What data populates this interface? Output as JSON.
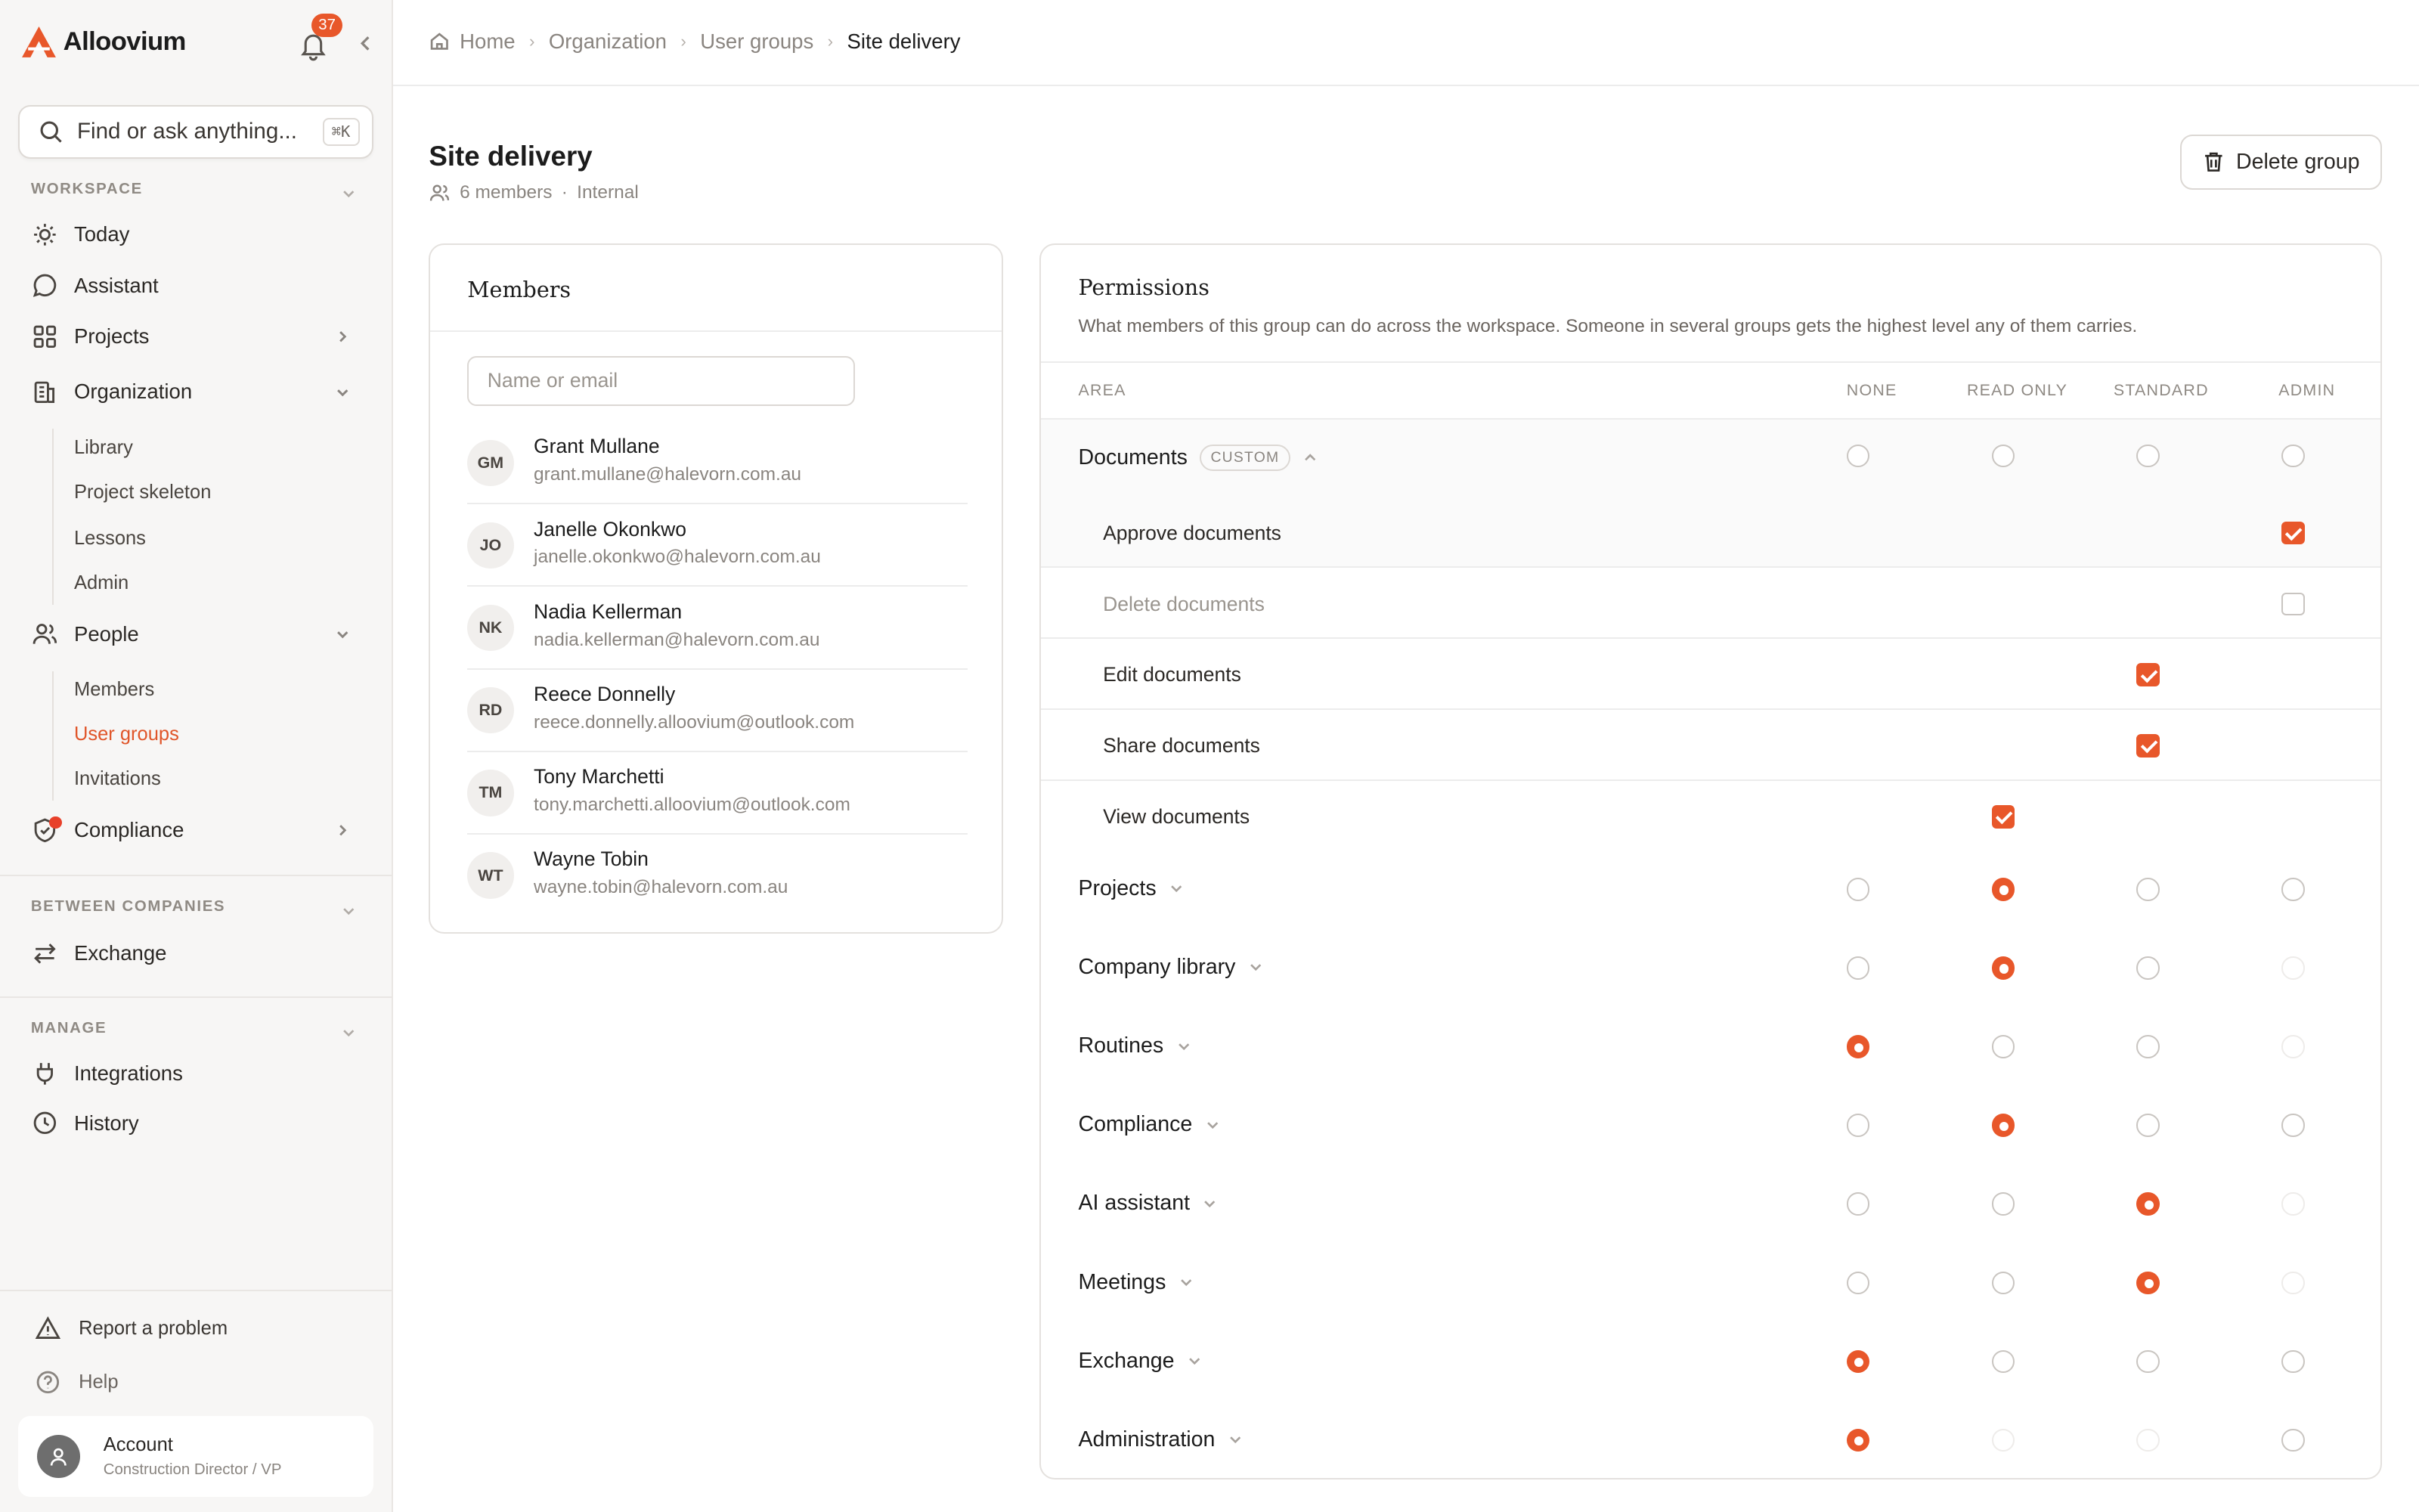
{
  "sidebar": {
    "app_name": "Alloovium",
    "notifications_count": "37",
    "search_placeholder": "Find or ask anything...",
    "search_shortcut": "⌘K",
    "workspace_label": "WORKSPACE",
    "between_label": "BETWEEN COMPANIES",
    "manage_label": "MANAGE",
    "items": {
      "today": "Today",
      "assistant": "Assistant",
      "projects": "Projects",
      "organization": "Organization",
      "library": "Library",
      "project_skeleton": "Project skeleton",
      "lessons": "Lessons",
      "admin": "Admin",
      "people": "People",
      "members": "Members",
      "user_groups": "User groups",
      "invitations": "Invitations",
      "compliance": "Compliance",
      "exchange": "Exchange",
      "integrations": "Integrations",
      "history": "History"
    },
    "report_problem": "Report a problem",
    "help": "Help",
    "account_name": "Account",
    "account_role": "Construction Director / VP",
    "accent_color": "#e8572a"
  },
  "breadcrumb": [
    "Home",
    "Organization",
    "User groups",
    "Site delivery"
  ],
  "page": {
    "title": "Site delivery",
    "members_count": "6 members",
    "visibility": "Internal",
    "delete_label": "Delete group"
  },
  "members_card": {
    "title": "Members",
    "search_placeholder": "Name or email",
    "members": [
      {
        "initials": "GM",
        "name": "Grant Mullane",
        "email": "grant.mullane@halevorn.com.au"
      },
      {
        "initials": "JO",
        "name": "Janelle Okonkwo",
        "email": "janelle.okonkwo@halevorn.com.au"
      },
      {
        "initials": "NK",
        "name": "Nadia Kellerman",
        "email": "nadia.kellerman@halevorn.com.au"
      },
      {
        "initials": "RD",
        "name": "Reece Donnelly",
        "email": "reece.donnelly.alloovium@outlook.com"
      },
      {
        "initials": "TM",
        "name": "Tony Marchetti",
        "email": "tony.marchetti.alloovium@outlook.com"
      },
      {
        "initials": "WT",
        "name": "Wayne Tobin",
        "email": "wayne.tobin@halevorn.com.au"
      }
    ]
  },
  "permissions": {
    "title": "Permissions",
    "description": "What members of this group can do across the workspace. Someone in several groups gets the highest level any of them carries.",
    "columns": {
      "area": "AREA",
      "none": "NONE",
      "read_only": "READ ONLY",
      "standard": "STANDARD",
      "admin": "ADMIN"
    },
    "custom_tag": "CUSTOM",
    "documents": {
      "label": "Documents",
      "sub": [
        {
          "label": "Approve documents",
          "checked": true,
          "level": "admin"
        },
        {
          "label": "Delete documents",
          "checked": false,
          "level": "admin"
        },
        {
          "label": "Edit documents",
          "checked": true,
          "level": "standard"
        },
        {
          "label": "Share documents",
          "checked": true,
          "level": "standard"
        },
        {
          "label": "View documents",
          "checked": true,
          "level": "read_only"
        }
      ]
    },
    "areas": [
      {
        "label": "Projects",
        "selected": "read_only",
        "disabled": []
      },
      {
        "label": "Company library",
        "selected": "read_only",
        "disabled": [
          "admin"
        ]
      },
      {
        "label": "Routines",
        "selected": "none",
        "disabled": [
          "admin"
        ]
      },
      {
        "label": "Compliance",
        "selected": "read_only",
        "disabled": []
      },
      {
        "label": "AI assistant",
        "selected": "standard",
        "disabled": [
          "admin"
        ]
      },
      {
        "label": "Meetings",
        "selected": "standard",
        "disabled": [
          "admin"
        ]
      },
      {
        "label": "Exchange",
        "selected": "none",
        "disabled": []
      },
      {
        "label": "Administration",
        "selected": "none",
        "disabled": [
          "read_only",
          "standard"
        ]
      }
    ]
  }
}
